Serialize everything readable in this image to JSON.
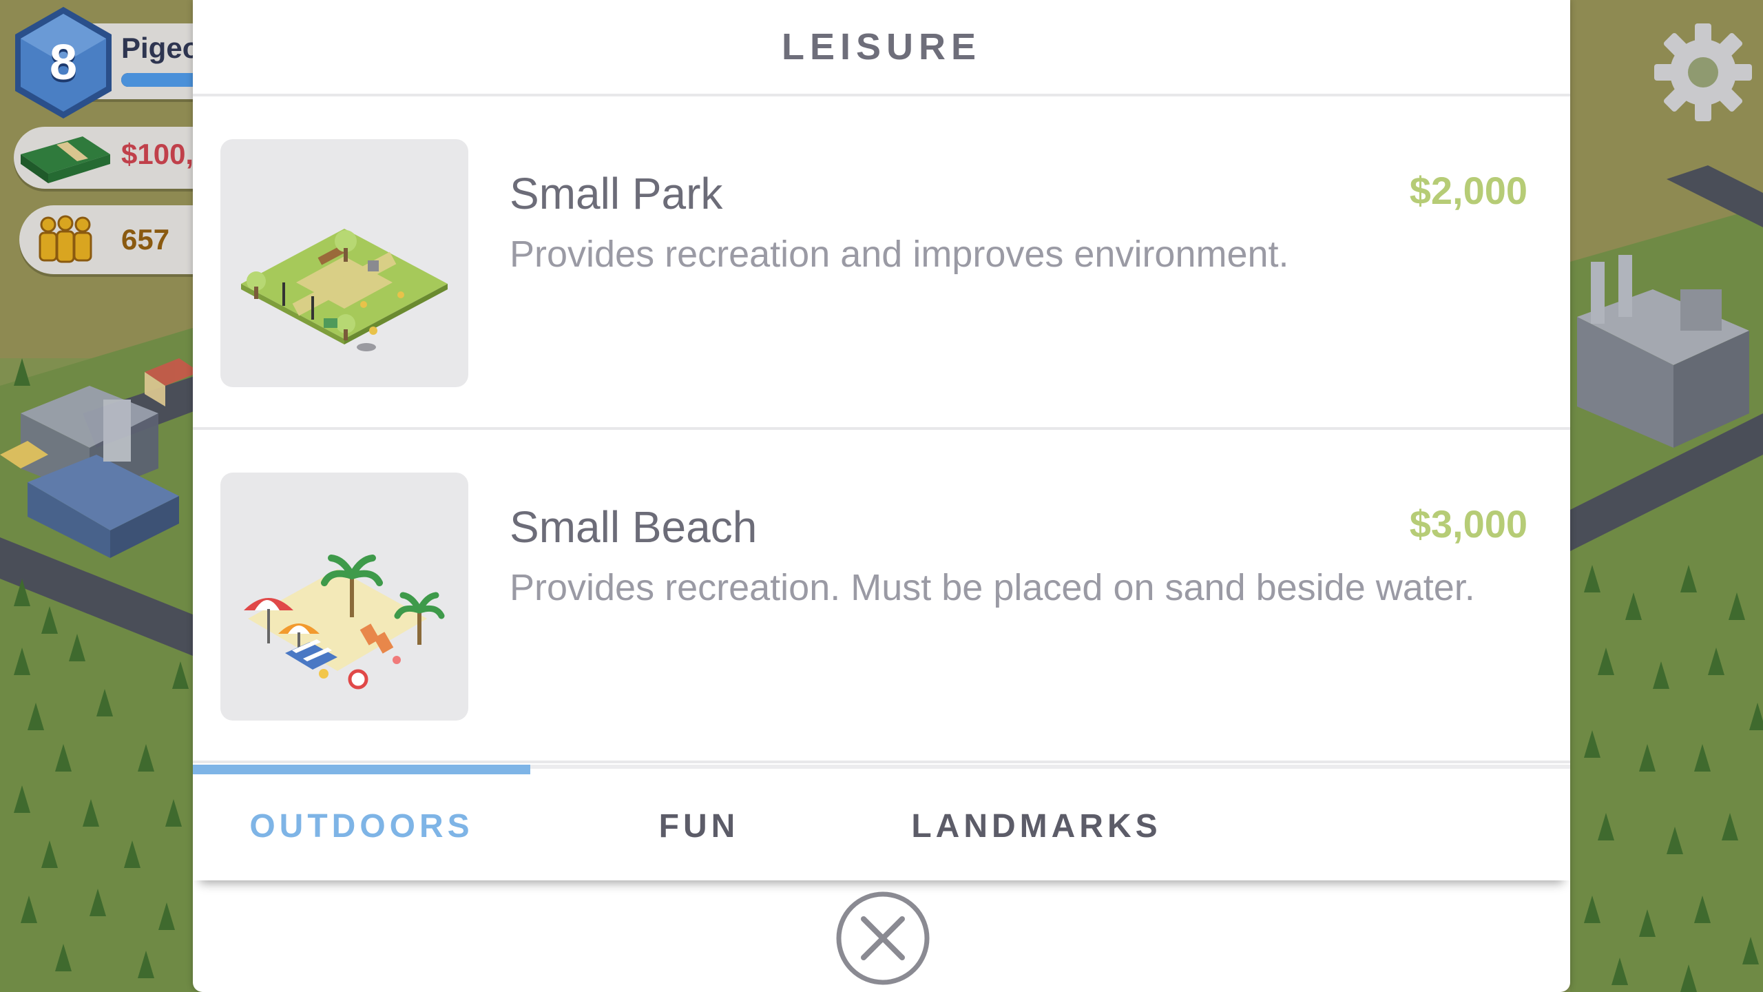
{
  "hud": {
    "level": "8",
    "player_name": "Pigeo",
    "xp_progress": 0.9,
    "money": "$100,",
    "population": "657"
  },
  "modal": {
    "title": "LEISURE",
    "items": [
      {
        "name": "Small Park",
        "price": "$2,000",
        "description": "Provides recreation and improves environment.",
        "icon": "park-icon"
      },
      {
        "name": "Small Beach",
        "price": "$3,000",
        "description": "Provides recreation. Must be placed on sand beside water.",
        "icon": "beach-icon"
      }
    ],
    "tabs": [
      {
        "label": "OUTDOORS",
        "active": true
      },
      {
        "label": "FUN",
        "active": false
      },
      {
        "label": "LANDMARKS",
        "active": false
      }
    ]
  },
  "colors": {
    "accent_blue": "#7eb4e6",
    "price_green": "#b6cc76",
    "money_red": "#c0404a",
    "population_brown": "#8a5a10"
  }
}
